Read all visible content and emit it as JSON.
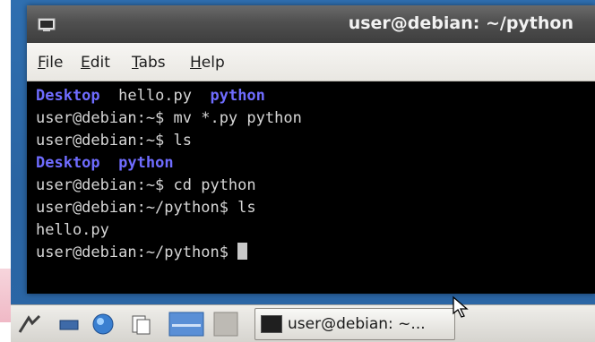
{
  "window": {
    "title": "user@debian: ~/python"
  },
  "menu": {
    "items": [
      {
        "accel": "F",
        "rest": "ile"
      },
      {
        "accel": "E",
        "rest": "dit"
      },
      {
        "accel": "T",
        "rest": "abs"
      },
      {
        "accel": "H",
        "rest": "elp"
      }
    ]
  },
  "terminal": {
    "lines": [
      [
        {
          "text": "Desktop",
          "dir": true
        },
        {
          "text": "  hello.py  ",
          "dir": false
        },
        {
          "text": "python",
          "dir": true
        }
      ],
      [
        {
          "text": "user@debian:~$ mv *.py python",
          "dir": false
        }
      ],
      [
        {
          "text": "user@debian:~$ ls",
          "dir": false
        }
      ],
      [
        {
          "text": "Desktop",
          "dir": true
        },
        {
          "text": "  ",
          "dir": false
        },
        {
          "text": "python",
          "dir": true
        }
      ],
      [
        {
          "text": "user@debian:~$ cd python",
          "dir": false
        }
      ],
      [
        {
          "text": "user@debian:~/python$ ls",
          "dir": false
        }
      ],
      [
        {
          "text": "hello.py",
          "dir": false
        }
      ],
      [
        {
          "text": "user@debian:~/python$ ",
          "dir": false
        }
      ]
    ]
  },
  "taskbar": {
    "task_label": "user@debian: ~..."
  },
  "colors": {
    "directory": "#6f6cff",
    "terminal_text": "#d6d6d6",
    "terminal_bg": "#000000",
    "desktop": "#2f6fb0"
  }
}
